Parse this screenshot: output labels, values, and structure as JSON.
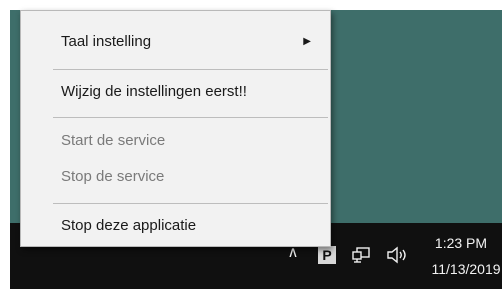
{
  "context_menu": {
    "items": [
      {
        "label": "Taal instelling",
        "enabled": true,
        "has_submenu": true
      },
      {
        "label": "Wijzig de instellingen eerst!!",
        "enabled": true,
        "has_submenu": false
      },
      {
        "label": "Start de service",
        "enabled": false,
        "has_submenu": false
      },
      {
        "label": "Stop de service",
        "enabled": false,
        "has_submenu": false
      },
      {
        "label": "Stop deze applicatie",
        "enabled": true,
        "has_submenu": false
      }
    ],
    "submenu_arrow": "▶"
  },
  "taskbar": {
    "tray_chevron": "∧",
    "tray_app_letter": "P",
    "icons": [
      "chevron-up-icon",
      "app-p-icon",
      "network-icon",
      "volume-icon"
    ],
    "clock": {
      "time": "1:23 PM",
      "date": "11/13/2019"
    }
  },
  "colors": {
    "desktop": "#3e6e6a",
    "taskbar": "#101010",
    "menu_background": "#f2f2f2",
    "disabled_text": "#7a7a7a"
  }
}
